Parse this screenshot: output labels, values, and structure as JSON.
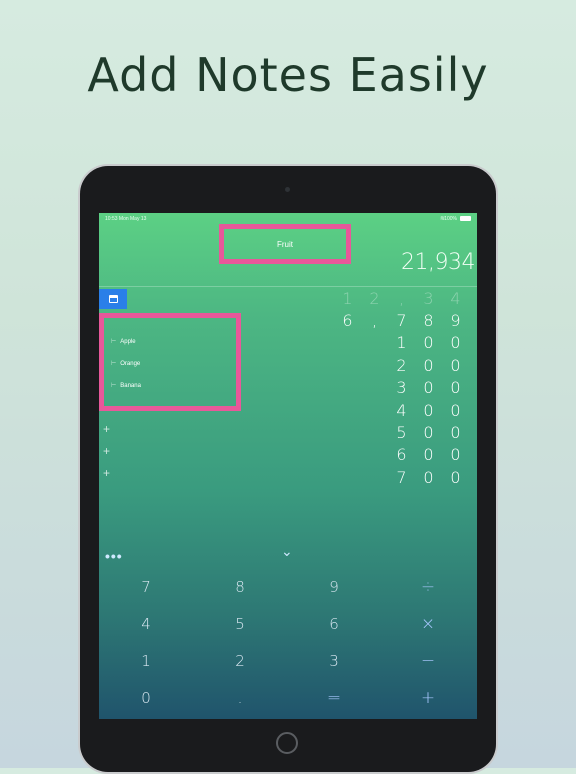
{
  "headline": "Add Notes Easily",
  "status_bar": {
    "time": "10:53 Mon May 13",
    "battery": "100%"
  },
  "note_title": "Fruit",
  "total": "21,934",
  "rows": [
    [
      "1",
      "2",
      ",",
      "3",
      "4"
    ],
    [
      "6",
      ",",
      "7",
      "8",
      "9"
    ],
    [
      "1",
      "0",
      "0"
    ],
    [
      "2",
      "0",
      "0"
    ],
    [
      "3",
      "0",
      "0"
    ],
    [
      "4",
      "0",
      "0"
    ],
    [
      "5",
      "0",
      "0"
    ],
    [
      "6",
      "0",
      "0"
    ],
    [
      "7",
      "0",
      "0"
    ]
  ],
  "notes": [
    "Apple",
    "Orange",
    "Banana"
  ],
  "plus_symbol": "+",
  "more_symbol": "•••",
  "collapse_symbol": "⌄",
  "keypad": [
    [
      "7",
      "8",
      "9",
      "÷"
    ],
    [
      "4",
      "5",
      "6",
      "×"
    ],
    [
      "1",
      "2",
      "3",
      "−"
    ],
    [
      "0",
      ".",
      "=",
      "+"
    ]
  ],
  "colors": {
    "highlight": "#e8589a",
    "accent_blue": "#2a7fe8"
  }
}
